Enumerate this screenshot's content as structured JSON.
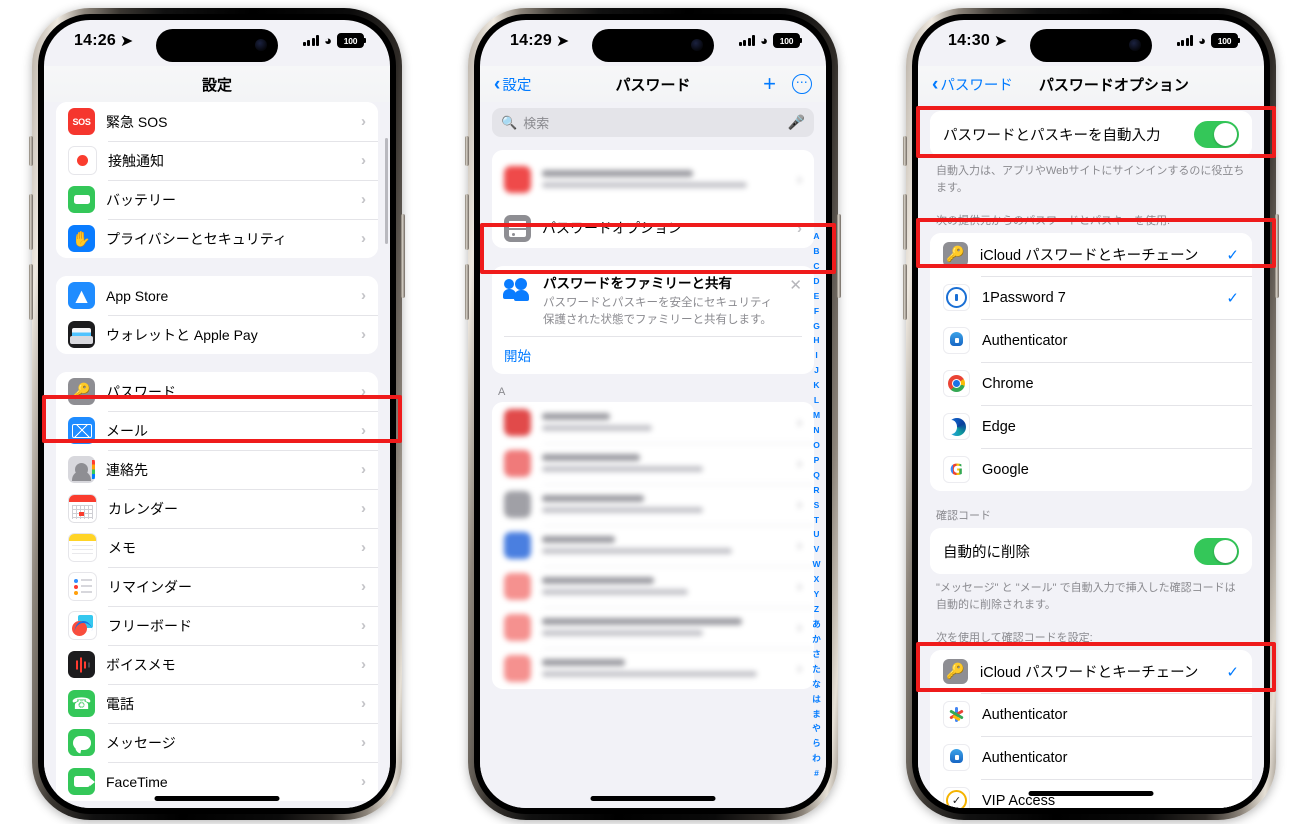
{
  "meta": {
    "accent_blue": "#007aff",
    "highlight_red": "#ef1b1b",
    "toggle_green": "#34c759"
  },
  "phone1": {
    "statusbar": {
      "time": "14:26",
      "location_icon": "location-arrow-icon",
      "battery": "100"
    },
    "nav": {
      "title": "設定"
    },
    "groups": [
      {
        "rows": [
          {
            "icon": "emergency-sos-icon",
            "label": "緊急 SOS"
          },
          {
            "icon": "exposure-notification-icon",
            "label": "接触通知"
          },
          {
            "icon": "battery-icon",
            "label": "バッテリー"
          },
          {
            "icon": "privacy-hand-icon",
            "label": "プライバシーとセキュリティ"
          }
        ]
      },
      {
        "rows": [
          {
            "icon": "app-store-icon",
            "label": "App Store"
          },
          {
            "icon": "wallet-icon",
            "label": "ウォレットと Apple Pay"
          }
        ]
      },
      {
        "rows": [
          {
            "icon": "passwords-key-icon",
            "label": "パスワード",
            "highlighted": true
          },
          {
            "icon": "mail-icon",
            "label": "メール"
          },
          {
            "icon": "contacts-icon",
            "label": "連絡先"
          },
          {
            "icon": "calendar-icon",
            "label": "カレンダー"
          },
          {
            "icon": "notes-icon",
            "label": "メモ"
          },
          {
            "icon": "reminders-icon",
            "label": "リマインダー"
          },
          {
            "icon": "freeform-icon",
            "label": "フリーボード"
          },
          {
            "icon": "voice-memos-icon",
            "label": "ボイスメモ"
          },
          {
            "icon": "phone-icon",
            "label": "電話"
          },
          {
            "icon": "messages-icon",
            "label": "メッセージ"
          },
          {
            "icon": "facetime-icon",
            "label": "FaceTime"
          }
        ]
      }
    ]
  },
  "phone2": {
    "statusbar": {
      "time": "14:29",
      "location_icon": "location-arrow-icon",
      "battery": "100"
    },
    "nav": {
      "back_label": "設定",
      "title": "パスワード",
      "add_icon": "plus-icon",
      "more_icon": "ellipsis-circle-icon"
    },
    "search": {
      "placeholder": "検索",
      "search_icon": "search-icon",
      "mic_icon": "microphone-icon"
    },
    "options_row": {
      "icon": "password-options-icon",
      "label": "パスワードオプション",
      "highlighted": true
    },
    "family_card": {
      "icon": "two-people-icon",
      "title": "パスワードをファミリーと共有",
      "description": "パスワードとパスキーを安全にセキュリティ保護された状態でファミリーと共有します。",
      "action": "開始",
      "close_icon": "close-x-icon"
    },
    "section_letter": "A",
    "index_items": [
      "A",
      "B",
      "C",
      "D",
      "E",
      "F",
      "G",
      "H",
      "I",
      "J",
      "K",
      "L",
      "M",
      "N",
      "O",
      "P",
      "Q",
      "R",
      "S",
      "T",
      "U",
      "V",
      "W",
      "X",
      "Y",
      "Z",
      "あ",
      "か",
      "さ",
      "た",
      "な",
      "は",
      "ま",
      "や",
      "ら",
      "わ",
      "#"
    ],
    "redacted_count_top": 1,
    "redacted_count_list": 7
  },
  "phone3": {
    "statusbar": {
      "time": "14:30",
      "location_icon": "location-arrow-icon",
      "battery": "100"
    },
    "nav": {
      "back_label": "パスワード",
      "title": "パスワードオプション"
    },
    "autofill_row": {
      "label": "パスワードとパスキーを自動入力",
      "toggle": "on",
      "highlighted": true
    },
    "autofill_footer": "自動入力は、アプリやWebサイトにサインインするのに役立ちます。",
    "providers_header": "次の提供元からのパスワードとパスキーを使用:",
    "providers": [
      {
        "icon": "icloud-keychain-icon",
        "label": "iCloud パスワードとキーチェーン",
        "checked": true,
        "highlighted": true
      },
      {
        "icon": "1password-icon",
        "label": "1Password 7",
        "checked": true
      },
      {
        "icon": "microsoft-authenticator-icon",
        "label": "Authenticator",
        "checked": false
      },
      {
        "icon": "chrome-icon",
        "label": "Chrome",
        "checked": false
      },
      {
        "icon": "edge-icon",
        "label": "Edge",
        "checked": false
      },
      {
        "icon": "google-icon",
        "label": "Google",
        "checked": false
      }
    ],
    "verification_header": "確認コード",
    "autodelete_row": {
      "label": "自動的に削除",
      "toggle": "on"
    },
    "autodelete_footer": "\"メッセージ\" と \"メール\" で自動入力で挿入した確認コードは自動的に削除されます。",
    "codes_header": "次を使用して確認コードを設定:",
    "code_providers": [
      {
        "icon": "icloud-keychain-icon",
        "label": "iCloud パスワードとキーチェーン",
        "checked": true,
        "highlighted": true
      },
      {
        "icon": "google-authenticator-icon",
        "label": "Authenticator",
        "checked": false
      },
      {
        "icon": "microsoft-authenticator-icon",
        "label": "Authenticator",
        "checked": false
      },
      {
        "icon": "vip-access-icon",
        "label": "VIP Access",
        "checked": false
      }
    ]
  }
}
